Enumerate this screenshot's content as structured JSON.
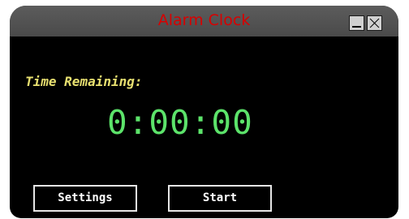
{
  "window": {
    "title": "Alarm Clock"
  },
  "controls": {
    "minimize_icon": "minimize-icon",
    "close_icon": "close-icon"
  },
  "timer": {
    "label": "Time Remaining:",
    "value": "0:00:00"
  },
  "buttons": {
    "settings_label": "Settings",
    "start_label": "Start"
  },
  "colors": {
    "title_text": "#d80000",
    "label_text": "#e8e070",
    "time_text": "#5ce36a",
    "background": "#000000"
  }
}
